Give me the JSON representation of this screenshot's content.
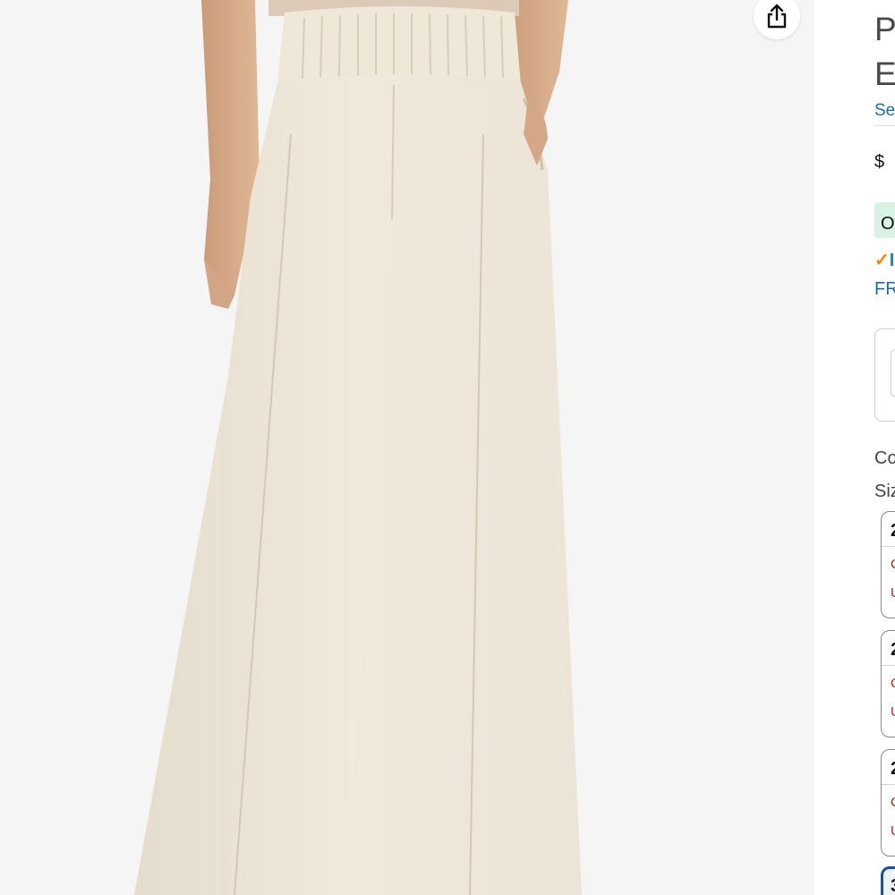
{
  "product_image": {
    "description_icon": "pants-image"
  },
  "share": {
    "icon": "share-icon"
  },
  "panel": {
    "title_line1": "P/",
    "title_line2": "E",
    "store_link": "Sea",
    "price": "$",
    "deal_badge": "O",
    "prime_check": "✓",
    "prime_text": "I",
    "free_delivery": "FR",
    "color_label": "Co",
    "size_label": "Siz",
    "size_options": [
      {
        "size": "2",
        "line1": "C",
        "line2": "U"
      },
      {
        "size": "2",
        "line1": "C",
        "line2": "U"
      },
      {
        "size": "2",
        "line1": "C",
        "line2": "U"
      },
      {
        "size": "3"
      }
    ]
  }
}
